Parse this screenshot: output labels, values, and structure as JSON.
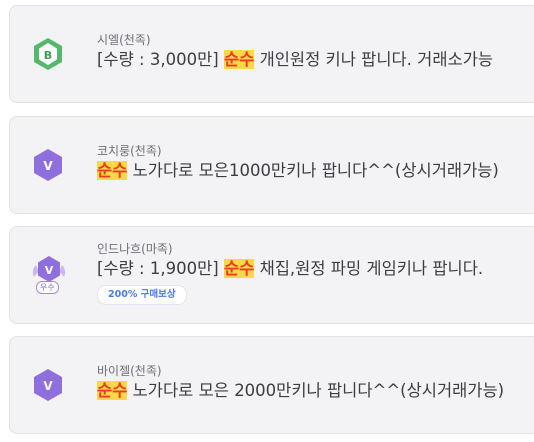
{
  "colors": {
    "highlight_bg": "#ffd84a",
    "highlight_text": "#f13a23",
    "badge_b": "#55b86c",
    "badge_v": "#8f6fde",
    "tag_text": "#4c7be0"
  },
  "listings": [
    {
      "badge_letter": "B",
      "badge_icon": "hexagon-badge-icon",
      "seller": "시엘(천족)",
      "prefix": "[수량 : 3,000만] ",
      "highlight": "순수",
      "suffix": " 개인원정 키나 팝니다. 거래소가능"
    },
    {
      "badge_letter": "V",
      "badge_icon": "hexagon-badge-icon",
      "seller": "코치룽(천족)",
      "prefix": "",
      "highlight": "순수",
      "suffix": " 노가다로 모은1000만키나 팝니다^^(상시거래가능)"
    },
    {
      "badge_letter": "V",
      "badge_icon": "winged-hexagon-badge-icon",
      "badge_sublabel": "우수",
      "seller": "인드나흐(마족)",
      "prefix": "[수량 : 1,900만] ",
      "highlight": "순수",
      "suffix": " 채집,원정 파밍 게임키나 팝니다.",
      "tag": "200% 구매보상"
    },
    {
      "badge_letter": "V",
      "badge_icon": "hexagon-badge-icon",
      "seller": "바이젤(천족)",
      "prefix": "",
      "highlight": "순수",
      "suffix": " 노가다로 모은 2000만키나 팝니다^^(상시거래가능)"
    }
  ]
}
